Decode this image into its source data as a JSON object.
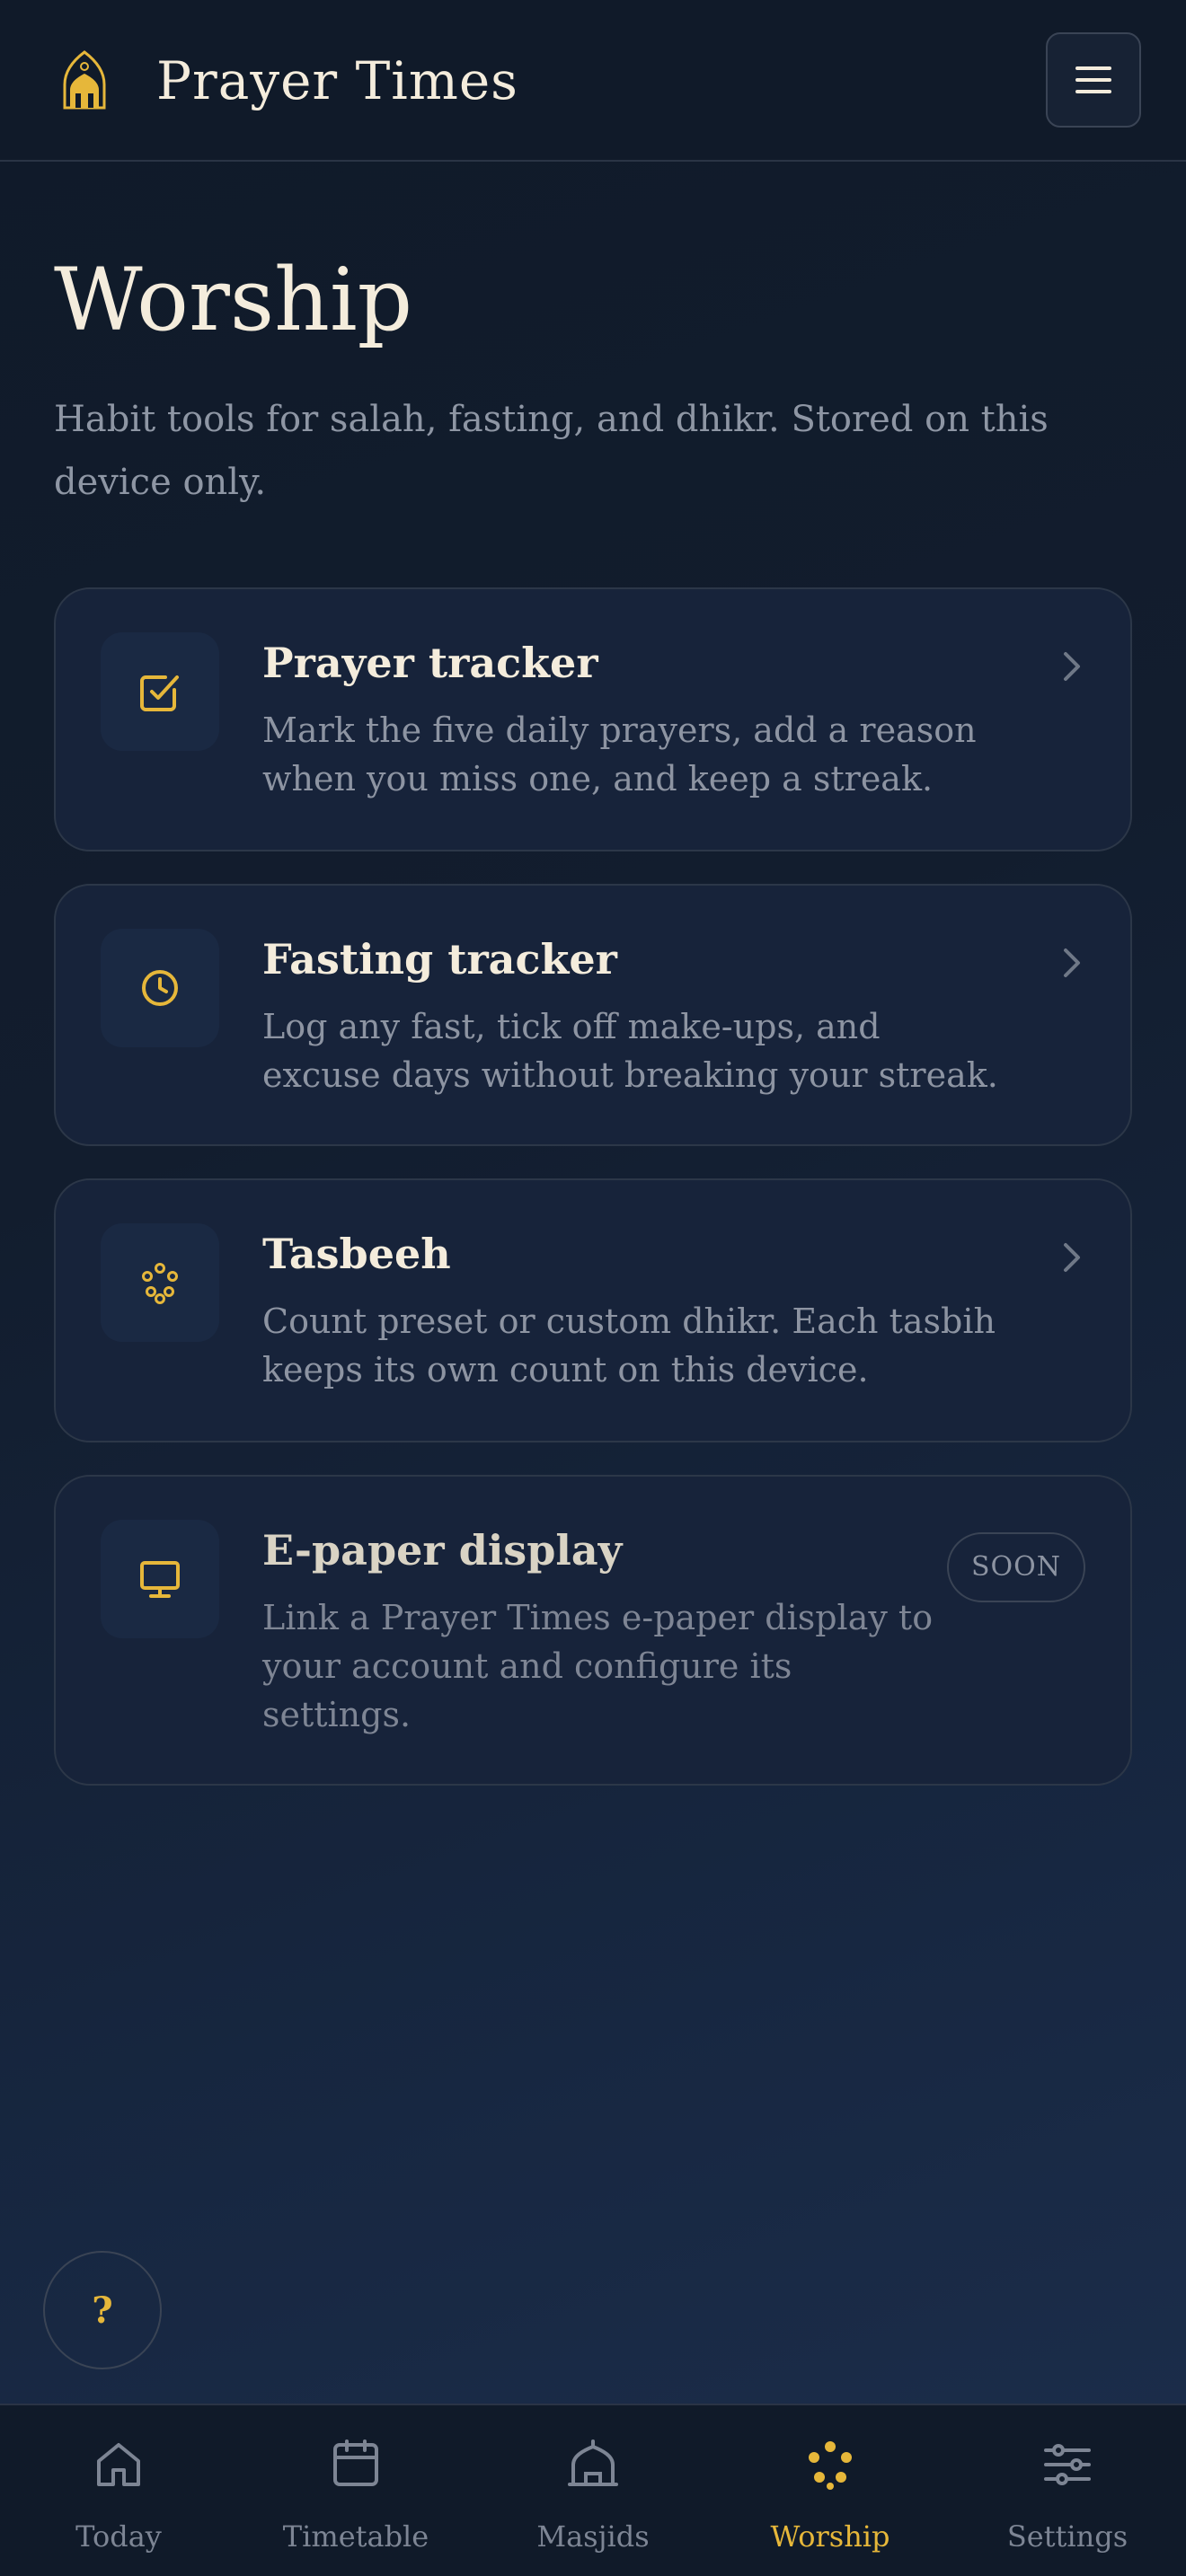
{
  "header": {
    "app_title": "Prayer Times",
    "logo_icon": "mosque-icon",
    "menu_icon": "hamburger-menu-icon"
  },
  "main": {
    "title": "Worship",
    "subtitle": "Habit tools for salah, fasting, and dhikr. Stored on this device only.",
    "cards": [
      {
        "icon": "checkbox-icon",
        "title": "Prayer tracker",
        "description": "Mark the five daily prayers, add a reason when you miss one, and keep a streak."
      },
      {
        "icon": "clock-icon",
        "title": "Fasting tracker",
        "description": "Log any fast, tick off make-ups, and excuse days without breaking your streak."
      },
      {
        "icon": "prayer-beads-icon",
        "title": "Tasbeeh",
        "description": "Count preset or custom dhikr. Each tasbih keeps its own count on this device."
      },
      {
        "icon": "monitor-icon",
        "title": "E-paper display",
        "description": "Link a Prayer Times e-paper display to your account and configure its settings.",
        "badge": "SOON"
      }
    ]
  },
  "help": {
    "label": "?"
  },
  "bottom_nav": {
    "items": [
      {
        "label": "Today",
        "icon": "home-icon"
      },
      {
        "label": "Timetable",
        "icon": "calendar-icon"
      },
      {
        "label": "Masjids",
        "icon": "masjid-icon"
      },
      {
        "label": "Worship",
        "icon": "prayer-beads-icon",
        "active": true
      },
      {
        "label": "Settings",
        "icon": "sliders-icon"
      }
    ]
  },
  "colors": {
    "background": "#111b2b",
    "accent_gold": "#e6b73a",
    "card_background": "#17233a",
    "text_primary": "#f4ecdc",
    "text_muted": "#8d94a2"
  }
}
